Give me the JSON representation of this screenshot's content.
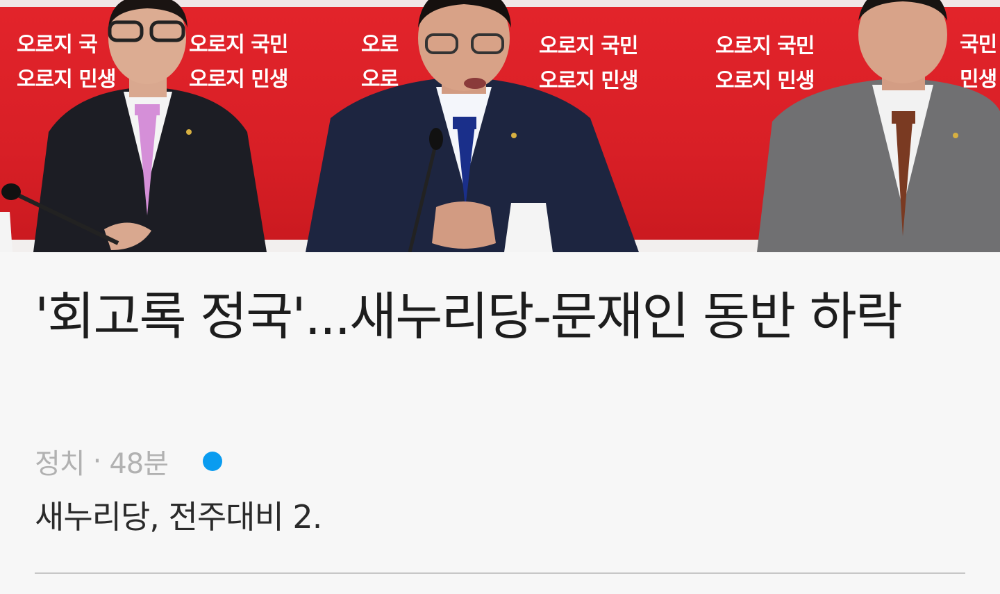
{
  "article": {
    "headline": "'회고록 정국'...새누리당-문재인 동반 하락",
    "category": "정치",
    "separator": "·",
    "time_ago": "48분",
    "snippet": "새누리당, 전주대비 2.",
    "unread": true
  },
  "photo": {
    "backdrop_slogans": [
      [
        "오로지 국",
        "오로지 민생"
      ],
      [
        "오로지 국민",
        "오로지 민생"
      ],
      [
        "오로",
        "오로"
      ],
      [
        "오로지 국민",
        "오로지 민생"
      ],
      [
        "오로지 국민",
        "오로지 민생"
      ],
      [
        "국민",
        "민생"
      ]
    ]
  },
  "colors": {
    "backdrop_red": "#d81f26",
    "unread_dot": "#0a9cf0",
    "headline": "#1d1d1d",
    "meta": "#b1b1b1",
    "divider": "#c7c7c7"
  }
}
